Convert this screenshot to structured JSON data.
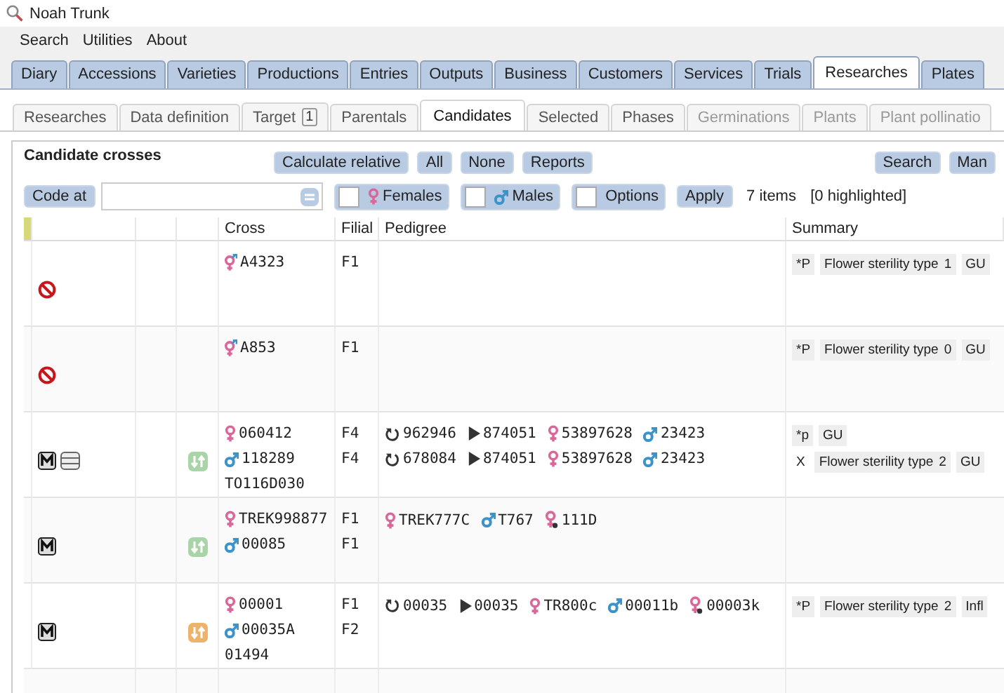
{
  "window": {
    "title": "Noah Trunk"
  },
  "menu": [
    "Search",
    "Utilities",
    "About"
  ],
  "main_tabs": [
    {
      "label": "Diary",
      "selected": false
    },
    {
      "label": "Accessions",
      "selected": false
    },
    {
      "label": "Varieties",
      "selected": false
    },
    {
      "label": "Productions",
      "selected": false
    },
    {
      "label": "Entries",
      "selected": false
    },
    {
      "label": "Outputs",
      "selected": false
    },
    {
      "label": "Business",
      "selected": false
    },
    {
      "label": "Customers",
      "selected": false
    },
    {
      "label": "Services",
      "selected": false
    },
    {
      "label": "Trials",
      "selected": false
    },
    {
      "label": "Researches",
      "selected": true
    },
    {
      "label": "Plates",
      "selected": false
    }
  ],
  "sub_tabs": [
    {
      "label": "Researches",
      "selected": false,
      "disabled": false
    },
    {
      "label": "Data definition",
      "selected": false,
      "disabled": false
    },
    {
      "label": "Target",
      "badge": "1",
      "selected": false,
      "disabled": false
    },
    {
      "label": "Parentals",
      "selected": false,
      "disabled": false
    },
    {
      "label": "Candidates",
      "selected": true,
      "disabled": false
    },
    {
      "label": "Selected",
      "selected": false,
      "disabled": false
    },
    {
      "label": "Phases",
      "selected": false,
      "disabled": false
    },
    {
      "label": "Germinations",
      "selected": false,
      "disabled": true
    },
    {
      "label": "Plants",
      "selected": false,
      "disabled": true
    },
    {
      "label": "Plant pollinatio",
      "selected": false,
      "disabled": true
    }
  ],
  "panel": {
    "title": "Candidate crosses",
    "buttons": [
      "Calculate relative",
      "All",
      "None",
      "Reports"
    ],
    "right_buttons": [
      "Search",
      "Man"
    ]
  },
  "filter": {
    "code_label": "Code at",
    "toggles": [
      {
        "kind": "female",
        "label": "Females",
        "checked": false
      },
      {
        "kind": "male",
        "label": "Males",
        "checked": false
      },
      {
        "kind": "plain",
        "label": "Options",
        "checked": false
      }
    ],
    "apply": "Apply",
    "count": "7 items",
    "highlighted": "[0 highlighted]"
  },
  "table": {
    "columns": [
      "Cross",
      "Filial",
      "Pedigree",
      "Summary"
    ],
    "rows": [
      {
        "icons": [
          {
            "kind": "blocked"
          }
        ],
        "cross": [
          {
            "kind": "both",
            "code": "A4323"
          }
        ],
        "filial": [
          "F1"
        ],
        "pedigree": [],
        "summary": [
          [
            {
              "kind": "mark",
              "text": "*P"
            },
            {
              "kind": "tag",
              "text": "Flower sterility type",
              "value": "1"
            },
            {
              "kind": "mark",
              "text": "GU"
            }
          ]
        ]
      },
      {
        "icons": [
          {
            "kind": "blocked"
          }
        ],
        "cross": [
          {
            "kind": "both",
            "code": "A853"
          }
        ],
        "filial": [
          "F1"
        ],
        "pedigree": [],
        "summary": [
          [
            {
              "kind": "mark",
              "text": "*P"
            },
            {
              "kind": "tag",
              "text": "Flower sterility type",
              "value": "0"
            },
            {
              "kind": "mark",
              "text": "GU"
            }
          ]
        ]
      },
      {
        "icons": [
          {
            "kind": "m"
          },
          {
            "kind": "list"
          }
        ],
        "swap": {
          "color": "#a9d4a8"
        },
        "cross": [
          {
            "kind": "female",
            "code": "060412"
          },
          {
            "kind": "male",
            "code": "118289"
          },
          {
            "kind": "plain",
            "code": "TO116D030"
          }
        ],
        "filial": [
          "F4",
          "F4"
        ],
        "pedigree": [
          [
            {
              "kind": "return",
              "text": "962946"
            },
            {
              "kind": "play",
              "text": "874051"
            },
            {
              "kind": "female",
              "text": "53897628"
            },
            {
              "kind": "male",
              "text": "23423"
            }
          ],
          [
            {
              "kind": "return",
              "text": "678084"
            },
            {
              "kind": "play",
              "text": "874051"
            },
            {
              "kind": "female",
              "text": "53897628"
            },
            {
              "kind": "male",
              "text": "23423"
            }
          ]
        ],
        "summary": [
          [
            {
              "kind": "mark",
              "text": "*p"
            },
            {
              "kind": "mark",
              "text": "GU"
            }
          ],
          [
            {
              "kind": "plain",
              "text": "X"
            },
            {
              "kind": "tag",
              "text": "Flower sterility type",
              "value": "2"
            },
            {
              "kind": "mark",
              "text": "GU"
            }
          ]
        ]
      },
      {
        "icons": [
          {
            "kind": "m"
          }
        ],
        "swap": {
          "color": "#a9d4a8"
        },
        "cross": [
          {
            "kind": "female",
            "code": "TREK998877"
          },
          {
            "kind": "male",
            "code": "00085"
          }
        ],
        "filial": [
          "F1",
          "F1"
        ],
        "pedigree": [
          [
            {
              "kind": "female",
              "text": "TREK777C"
            },
            {
              "kind": "male",
              "text": "T767"
            },
            {
              "kind": "female-dot",
              "text": "111D"
            }
          ]
        ],
        "summary": []
      },
      {
        "icons": [
          {
            "kind": "m"
          }
        ],
        "swap": {
          "color": "#eeb26a"
        },
        "cross": [
          {
            "kind": "female",
            "code": "00001"
          },
          {
            "kind": "male",
            "code": "00035A"
          },
          {
            "kind": "plain",
            "code": "01494"
          }
        ],
        "filial": [
          "F1",
          "F2"
        ],
        "pedigree": [
          [
            {
              "kind": "return",
              "text": "00035"
            },
            {
              "kind": "play",
              "text": "00035"
            },
            {
              "kind": "female",
              "text": "TR800c"
            },
            {
              "kind": "male",
              "text": "00011b"
            },
            {
              "kind": "female-dot",
              "text": "00003k"
            }
          ]
        ],
        "summary": [
          [
            {
              "kind": "mark",
              "text": "*P"
            },
            {
              "kind": "tag",
              "text": "Flower sterility type",
              "value": "2"
            },
            {
              "kind": "mark",
              "text": "Infl"
            }
          ]
        ]
      }
    ]
  }
}
